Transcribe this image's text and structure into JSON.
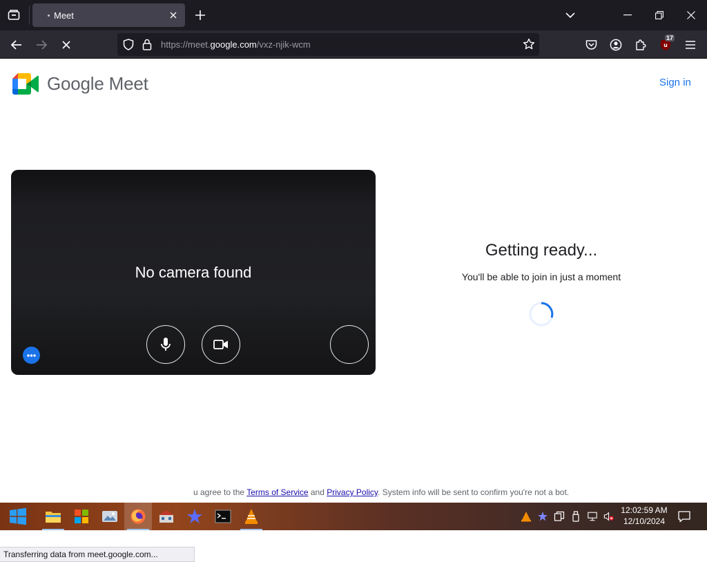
{
  "browser": {
    "tab": {
      "title": "Meet"
    },
    "url": {
      "prefix": "https://meet.",
      "host": "google.com",
      "path": "/vxz-njik-wcm"
    },
    "extension_badge": "17",
    "status_text": "Transferring data from meet.google.com..."
  },
  "page": {
    "brand_name": "Google Meet",
    "sign_in_label": "Sign in",
    "preview": {
      "message": "No camera found"
    },
    "ready": {
      "title": "Getting ready...",
      "subtitle": "You'll be able to join in just a moment"
    },
    "footer": {
      "prefix": "u agree to the ",
      "terms_label": "Terms of Service",
      "middle": " and ",
      "privacy_label": "Privacy Policy",
      "suffix": ". System info will be sent to confirm you're not a bot."
    }
  },
  "taskbar": {
    "time": "12:02:59 AM",
    "date": "12/10/2024",
    "apps": [
      "start-icon",
      "file-explorer-icon",
      "store-icon",
      "photos-icon",
      "firefox-icon",
      "app-icon",
      "star-app-icon",
      "terminal-icon",
      "vlc-icon"
    ]
  },
  "colors": {
    "accent": "#1a73e8",
    "tab_bg": "#42414d",
    "chrome_bg": "#1c1b22",
    "toolbar_bg": "#2b2a33"
  }
}
